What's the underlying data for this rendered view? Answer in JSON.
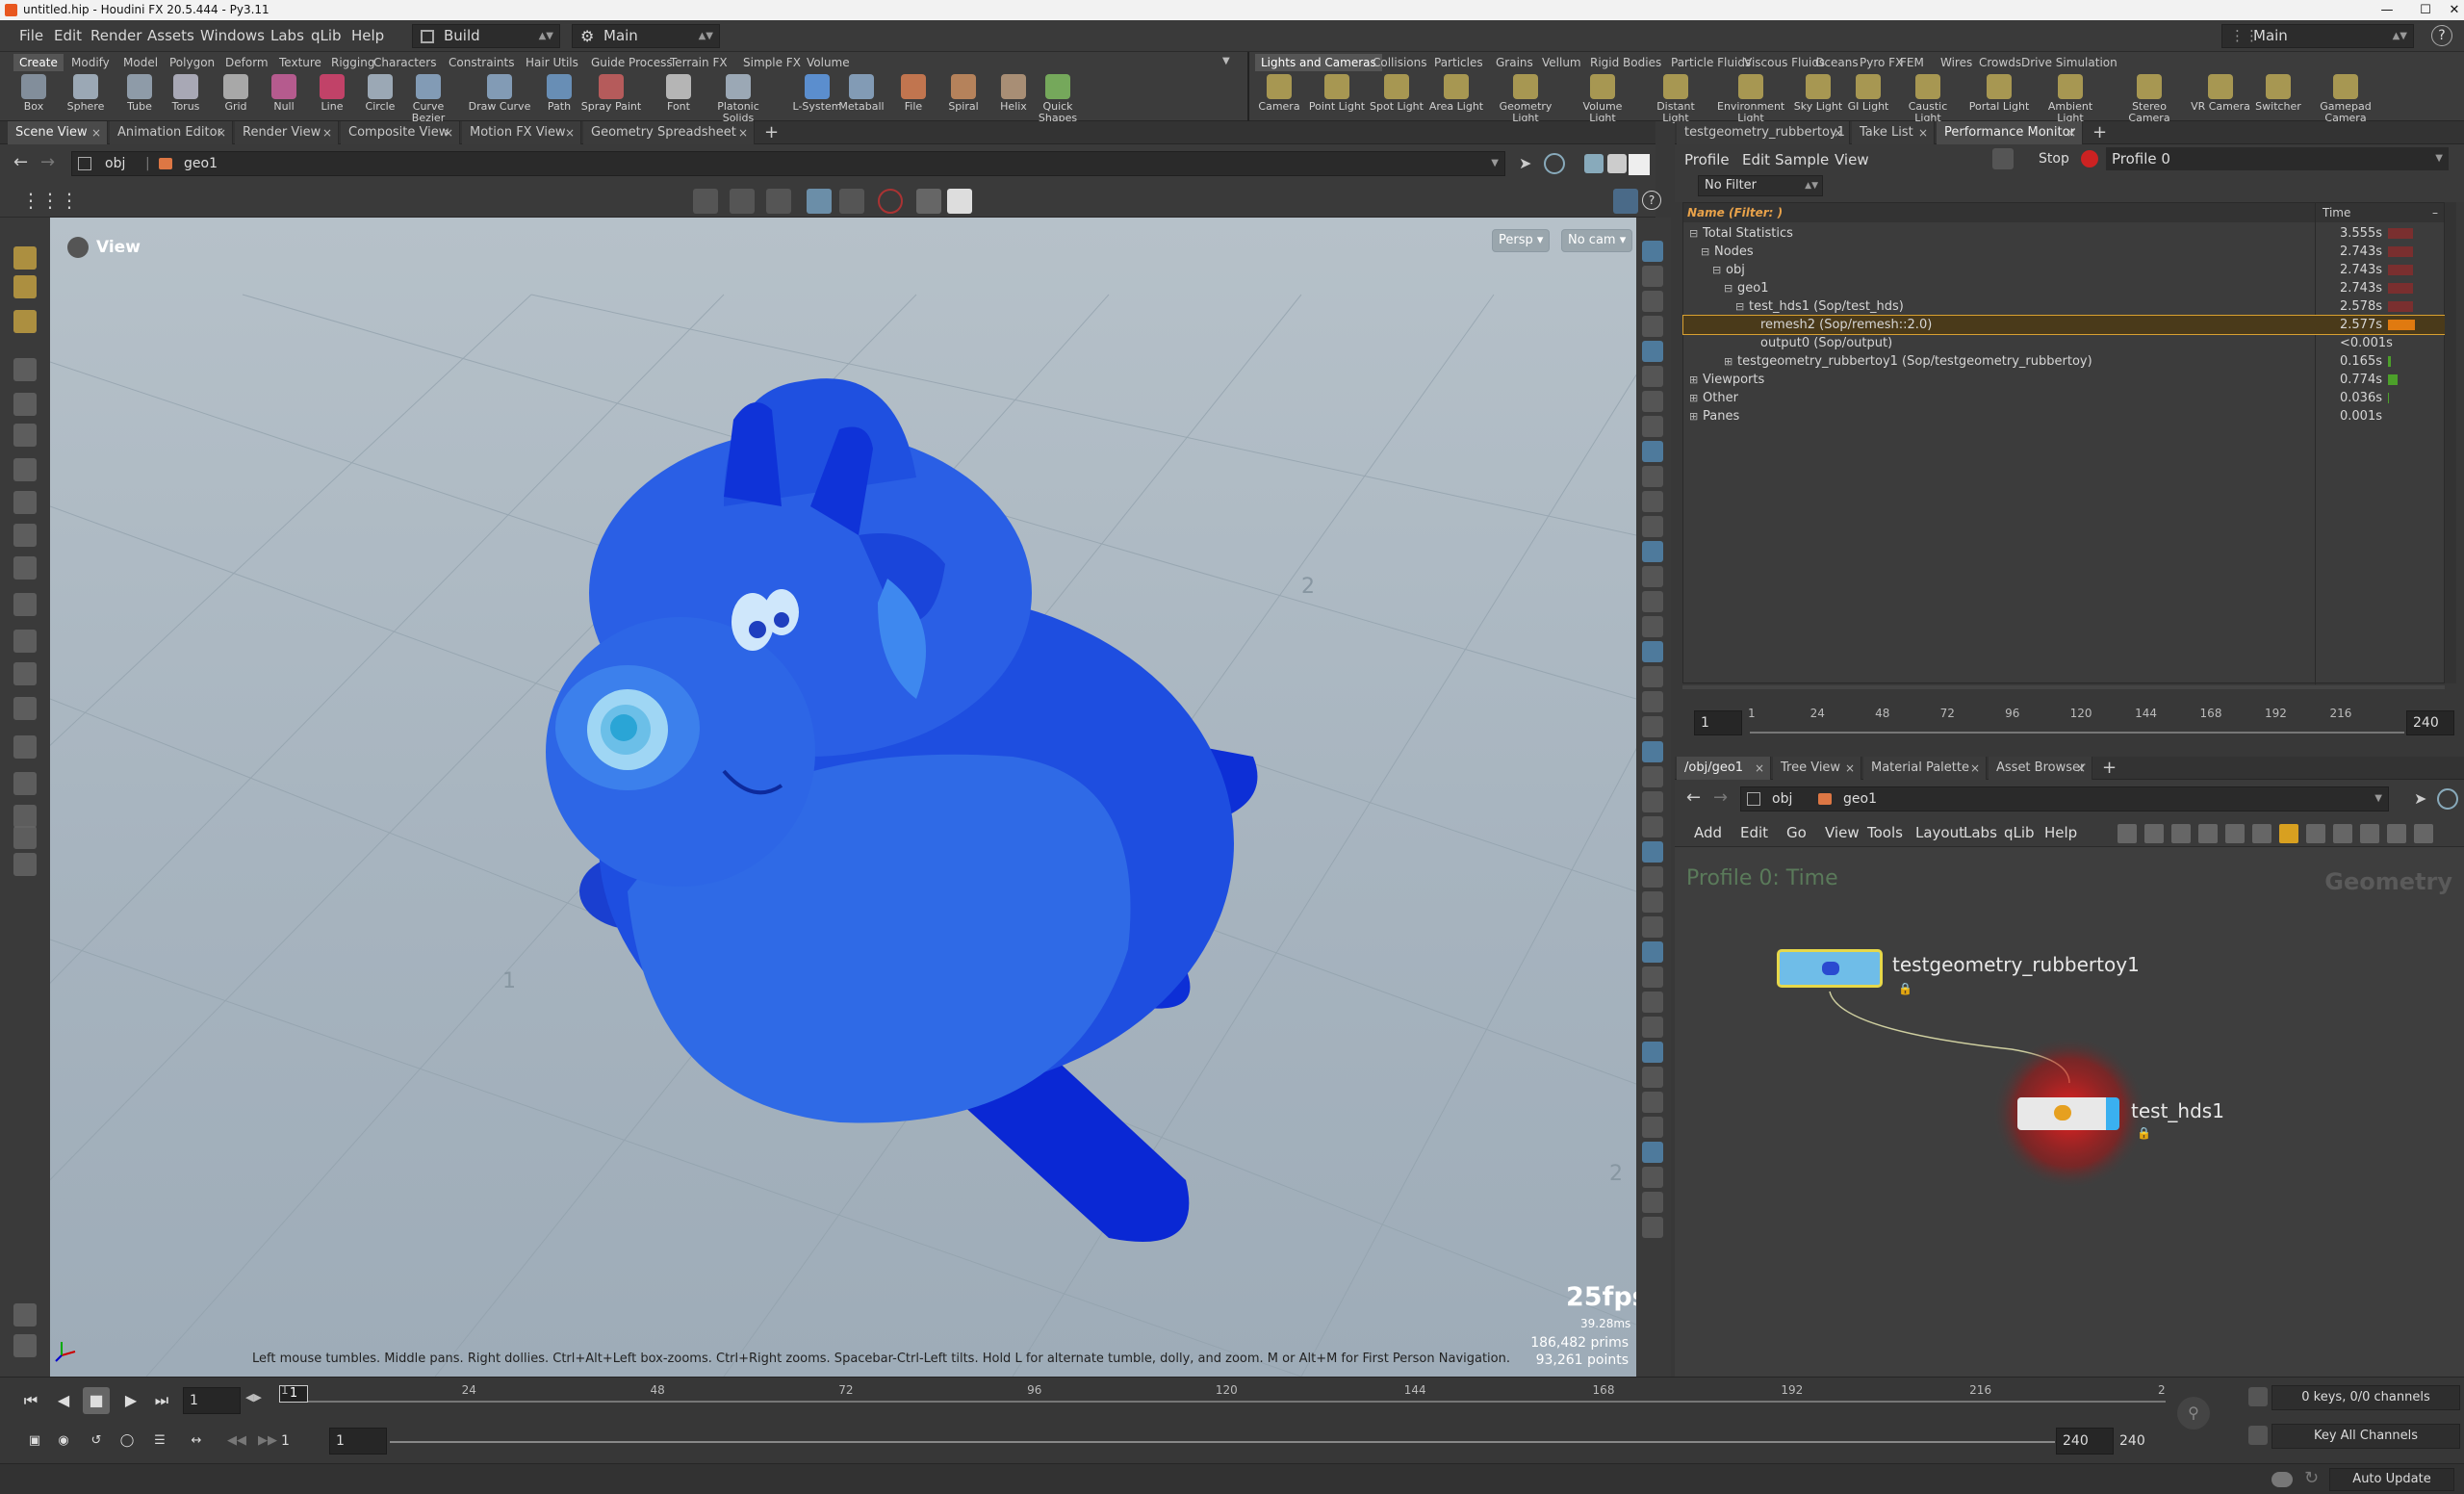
{
  "window": {
    "title": "untitled.hip - Houdini FX 20.5.444 - Py3.11",
    "controls": [
      "—",
      "☐",
      "✕"
    ]
  },
  "menubar": {
    "items": [
      "File",
      "Edit",
      "Render",
      "Assets",
      "Windows",
      "Labs",
      "qLib",
      "Help"
    ],
    "desktop": "Build",
    "context": "Main",
    "right_context": "Main",
    "help_icon": "?"
  },
  "shelf_left": {
    "tabs": [
      "Create",
      "Modify",
      "Model",
      "Polygon",
      "Deform",
      "Texture",
      "Rigging",
      "Characters",
      "Constraints",
      "Hair Utils",
      "Guide Process",
      "Terrain FX",
      "Simple FX",
      "Volume"
    ],
    "tools": [
      "Box",
      "Sphere",
      "Tube",
      "Torus",
      "Grid",
      "Null",
      "Line",
      "Circle",
      "Curve Bezier",
      "Draw Curve",
      "Path",
      "Spray Paint",
      "Font",
      "Platonic Solids",
      "L-System",
      "Metaball",
      "File",
      "Spiral",
      "Helix",
      "Quick Shapes"
    ]
  },
  "shelf_right": {
    "tabs": [
      "Lights and Cameras",
      "Collisions",
      "Particles",
      "Grains",
      "Vellum",
      "Rigid Bodies",
      "Particle Fluids",
      "Viscous Fluids",
      "Oceans",
      "Pyro FX",
      "FEM",
      "Wires",
      "Crowds",
      "Drive Simulation"
    ],
    "tools": [
      "Camera",
      "Point Light",
      "Spot Light",
      "Area Light",
      "Geometry Light",
      "Volume Light",
      "Distant Light",
      "Environment Light",
      "Sky Light",
      "GI Light",
      "Caustic Light",
      "Portal Light",
      "Ambient Light",
      "Stereo Camera",
      "VR Camera",
      "Switcher",
      "Gamepad Camera"
    ]
  },
  "left_tabs": [
    "Scene View",
    "Animation Editor",
    "Render View",
    "Composite View",
    "Motion FX View",
    "Geometry Spreadsheet"
  ],
  "path": {
    "root": "obj",
    "node": "geo1"
  },
  "viewport": {
    "label": "View",
    "persp": "Persp ▾",
    "cam": "No cam ▾",
    "help": "Left mouse tumbles. Middle pans. Right dollies. Ctrl+Alt+Left box-zooms. Ctrl+Right zooms. Spacebar-Ctrl-Left tilts. Hold L for alternate tumble, dolly, and zoom. M or Alt+M for First Person Navigation.",
    "fps": "25fps",
    "ms": "39.28ms",
    "prims": "186,482  prims",
    "points": "93,261  points",
    "grid_labels": [
      "1",
      "2",
      "1",
      "2",
      "1",
      "2"
    ]
  },
  "timeline": {
    "frame": "1",
    "start": "1",
    "start2": "1",
    "end": "240",
    "end2": "240",
    "ticks": [
      "1",
      "24",
      "48",
      "72",
      "96",
      "120",
      "144",
      "168",
      "192",
      "216",
      "2"
    ]
  },
  "right_top_tabs": [
    "testgeometry_rubbertoy1",
    "Take List",
    "Performance Monitor"
  ],
  "perf": {
    "menus": [
      "Profile",
      "Edit",
      "Sample",
      "View"
    ],
    "stop": "Stop",
    "profile": "Profile 0",
    "filter": "No Filter",
    "col_name": "Name (Filter: )",
    "col_time": "Time",
    "rows": [
      {
        "name": "Total Statistics",
        "time": "3.555s"
      },
      {
        "name": "Nodes",
        "time": "2.743s"
      },
      {
        "name": "obj",
        "time": "2.743s"
      },
      {
        "name": "geo1",
        "time": "2.743s"
      },
      {
        "name": "test_hds1 (Sop/test_hds)",
        "time": "2.578s"
      },
      {
        "name": "remesh2 (Sop/remesh::2.0)",
        "time": "2.577s"
      },
      {
        "name": "output0 (Sop/output)",
        "time": "<0.001s"
      },
      {
        "name": "testgeometry_rubbertoy1 (Sop/testgeometry_rubbertoy)",
        "time": "0.165s"
      },
      {
        "name": "Viewports",
        "time": "0.774s"
      },
      {
        "name": "Other",
        "time": "0.036s"
      },
      {
        "name": "Panes",
        "time": "0.001s"
      }
    ],
    "slider": {
      "start": "1",
      "end": "240",
      "ticks": [
        "1",
        "24",
        "48",
        "72",
        "96",
        "120",
        "144",
        "168",
        "192",
        "216"
      ]
    }
  },
  "right_bottom_tabs": [
    "/obj/geo1",
    "Tree View",
    "Material Palette",
    "Asset Browser"
  ],
  "network": {
    "menus": [
      "Add",
      "Edit",
      "Go",
      "View",
      "Tools",
      "Layout",
      "Labs",
      "qLib",
      "Help"
    ],
    "profile_label": "Profile 0: Time",
    "context_label": "Geometry",
    "node1": "testgeometry_rubbertoy1",
    "node2": "test_hds1"
  },
  "channels": {
    "keys": "0 keys, 0/0 channels",
    "keyall": "Key All Channels",
    "autoupdate": "Auto Update"
  }
}
